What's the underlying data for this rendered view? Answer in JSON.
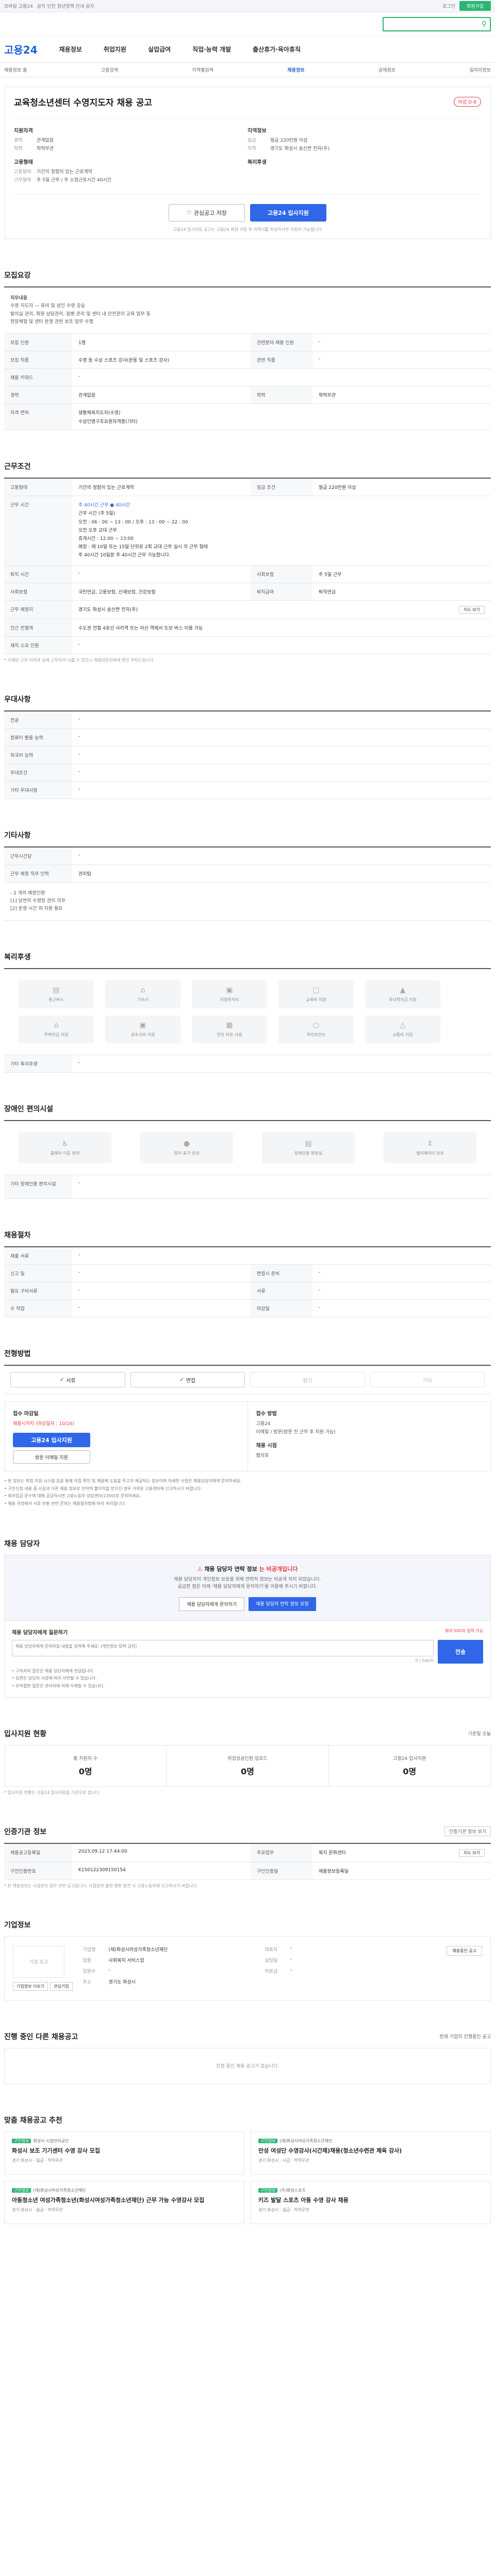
{
  "topbar": {
    "left": "모바일 고용24",
    "notice": "공지 인천 청년정책 안내 공지",
    "right": "로그인",
    "cta": "회원가입"
  },
  "search": {
    "icon": "search-icon"
  },
  "gnb": {
    "logo": "고용24",
    "menu": [
      "채용정보",
      "취업지원",
      "실업급여",
      "직업·능력 개발",
      "출산휴가·육아휴직"
    ]
  },
  "subnav": [
    "채용정보 홈",
    "고용검색",
    "지역별검색",
    "채용정보",
    "공채정보",
    "일자리정보"
  ],
  "job": {
    "title": "교육청소년센터 수영지도자 채용 공고",
    "dday": "마감 D-8",
    "left_head": "지원자격",
    "left_rows": [
      [
        "경력",
        "관계없음"
      ],
      [
        "학력",
        "학력무관"
      ]
    ],
    "left_head2": "고용형태",
    "left_rows2": [
      [
        "고용형태",
        "기간의 정함이 있는 근로계약"
      ],
      [
        "근무형태",
        "주 5일 근무 / 주 소정근로시간 40시간"
      ]
    ],
    "right_head": "지역정보",
    "right_rows": [
      [
        "임금",
        "월급 220만원 이상"
      ],
      [
        "지역",
        "경기도 화성시 송산면 전자(주)"
      ]
    ],
    "right_head2": "복리후생",
    "btn_scrap": "관심공고 저장",
    "btn_apply": "고용24 입사지원",
    "notice": "고용24 입사지원 공고는 고용24 회원 가입 후 이력서를 작성하시면 지원이 가능합니다"
  },
  "sec_recruit": {
    "title": "모집요강",
    "duty_label": "직무내용",
    "duty": "수영 지도자 — 유아 및 성인 수영 강습\n탈의실 관리, 회원 상담관리, 질병 관리 및 센터 내 안전관리 교육 업무 등\n현장체험 및 센터 운영 관련 보조 업무 수행",
    "rows": [
      [
        "모집 인원",
        "1명",
        "관련분야 채용 인원",
        "-"
      ],
      [
        "모집 직종",
        "수영 등 수상 스포츠 강사(운동 및 스포츠 강사)",
        "관련 직종",
        "-"
      ],
      [
        "채용 키워드",
        "-",
        "",
        ""
      ],
      [
        "경력",
        "관계없음",
        "학력",
        "학력무관"
      ]
    ],
    "license_label": "자격 면허",
    "licenses": [
      "생활체육지도자(수영)",
      "수상인명구조요원자격증(기타)"
    ]
  },
  "sec_work": {
    "title": "근무조건",
    "rows_top": [
      [
        "고용형태",
        "기간의 정함이 있는 근로계약",
        "임금 조건",
        "월급 220만원 이상"
      ]
    ],
    "bonus": "주 40시간 근무 ● 40시간",
    "time_label": "근무 시간",
    "time_lines": [
      "근무 시간 (주 5일)",
      "오전 : 06 : 00 ~ 13 : 00 / 오후 : 13 : 00 ~ 22 : 00",
      "오전 오후 교대 근무",
      "",
      "휴게시간 : 12:00 ~ 13:00",
      "",
      "예정 : 매 10일 또는 15일 단위로 2회 교대 근무 실시 의 근무 형태",
      "주 40시간 10일분 주 40시간 근무 가능합니다."
    ],
    "rows": [
      [
        "퇴직 시간",
        "-",
        "사회보험",
        "주 5일 근무"
      ],
      [
        "사회보험",
        "국민연금, 고용보험, 산재보험, 건강보험",
        "퇴직급여",
        "퇴직연금"
      ],
      [
        "근무 예정지",
        "경기도 화성시 송산면 전자(주)",
        "",
        ""
      ],
      [
        "인근 전철역",
        "수도권 전철 4호선 사리역 또는 아산 역에서 도보 버스 이용 가능",
        "",
        ""
      ],
      [
        "재직 소요 인원",
        "-",
        "",
        ""
      ]
    ],
    "map_btn": "지도 보기",
    "footnote": "* 기재된 근무 지역과 실제 근무지가 다를 수 있으니 채용담당자에게 확인 부탁드립니다."
  },
  "sec_prefer": {
    "title": "우대사항",
    "rows": [
      [
        "전공",
        "-"
      ],
      [
        "컴퓨터 활용 능력",
        "-"
      ],
      [
        "외국어 능력",
        "-"
      ],
      [
        "우대조건",
        "-"
      ],
      [
        "기타 우대사항",
        "-"
      ]
    ]
  },
  "sec_etc": {
    "title": "기타사항",
    "rows": [
      [
        "근무시간당",
        "-"
      ],
      [
        "근무 예정 직무 인력",
        "관리팀"
      ]
    ],
    "desc": "-  2 개의 예정인원\n[1] 당연히 수영장 관리 의무\n[2] 운영 시간 외 지원 필요"
  },
  "sec_welfare": {
    "title": "복리후생",
    "items": [
      "통근버스",
      "기숙사",
      "차량유지비",
      "교육비 지원",
      "자녀학자금 지원",
      "주택자금 지원",
      "경조사비 지원",
      "연차 자유 사용",
      "복지포인트",
      "교통비 지원"
    ],
    "etc_label": "기타 복리후생",
    "etc_value": "-"
  },
  "sec_disabled": {
    "title": "장애인 편의시설",
    "items": [
      "휠체어 이동 편의",
      "점자 표기 안내",
      "장애인용 화장실",
      "엘리베이터 보유"
    ],
    "etc_label": "기타 장애인용 편의시설",
    "etc_value": "-"
  },
  "sec_process": {
    "title": "채용절차",
    "rows": [
      [
        "제출 서류",
        "-",
        "",
        ""
      ],
      [
        "신고 일",
        "-",
        "면접시 준비",
        "-"
      ],
      [
        "필요 구비서류",
        "-",
        "서류",
        "-"
      ],
      [
        "수 작업",
        "-",
        "마감일",
        "-"
      ]
    ]
  },
  "sec_apply": {
    "title": "전형방법",
    "chips": [
      {
        "label": "서류",
        "on": true
      },
      {
        "label": "면접",
        "on": true
      },
      {
        "label": "필기",
        "on": false
      },
      {
        "label": "기타",
        "on": false
      }
    ],
    "left_head": "접수 마감일",
    "left_date": "채용시까지 (마감일자 : 10/16)",
    "left_btn": "고용24 입사지원",
    "left_btn2": "방문 이메일 지원",
    "right_head": "접수 방법",
    "right_lines": [
      "고용24",
      "이메일 / 방문(방문 전 근무 후 지원 가능)"
    ],
    "right_head2": "채용 시점",
    "right_val": "협의후",
    "bullets": [
      "• 본 정보는 취업 지원 시스템 등을 통해 직접 확인 및 채용에 도움을 주고자 제공되는 정보이며 자세한 사항은 채용담당자에게 문의하세요.",
      "• 구인신청 내용 중 사실과 다른 채용 정보로 인하여 불이익을 받으신 경우 가까운 고용센터에 신고하시기 바랍니다.",
      "• 최저임금 준수에 대해 궁금하시면 고용노동부 상담센터(1350)로 문의하세요.",
      "• 채용 과정에서 서류 반환 관련 문의는 채용절차법에 따라 처리됩니다."
    ]
  },
  "sec_contact": {
    "title": "채용 담당자",
    "banner_h1": "채용 담당자 연락 정보",
    "banner_h2": " 는 비공개입니다",
    "banner_p": "채용 담당자의 개인정보 보호를 위해 연락처 정보는 비공개 처리 되었습니다.\n궁금한 점은 아래 '채용 담당자에게 문의하기'를 이용해 주시기 바랍니다.",
    "b1": "채용 담당자에게 문의하기",
    "b2": "채용 담당자 연락 정보 요청",
    "inq_label": "채용 담당자에게 질문하기",
    "inq_right": "최대 500자 입력 가능",
    "inq_placeholder": "채용 담당자에게 문의하실 내용을 입력해 주세요. (개인정보 입력 금지)",
    "inq_count": "0 / 500자",
    "send": "전송",
    "notes": [
      "• 구직자의 질문은 채용 담당자에게 전달됩니다.",
      "• 답변은 담당자 사정에 따라 지연될 수 있습니다.",
      "• 부적절한 질문은 관리자에 의해 삭제될 수 있습니다."
    ]
  },
  "sec_stats": {
    "title": "입사지원 현황",
    "right": "기준일 오늘",
    "items": [
      [
        "총 지원자 수",
        "0명"
      ],
      [
        "취업성공인원 업로드",
        "0명"
      ],
      [
        "고용24 입사지원",
        "0명"
      ]
    ],
    "note": "* 입사지원 현황은 고용24 입사지원을 기준으로 합니다."
  },
  "sec_info": {
    "title": "인증기관 정보",
    "right": "인증기관 정보 보기",
    "rows": [
      [
        "채용공고등록일",
        "2023.09.12 17:44:00",
        "주요업무",
        "복지 문화센터"
      ],
      [
        "구인인증번호",
        "K150122309150154",
        "구인인증일",
        "채용정보등록일"
      ]
    ],
    "map_btn": "지도 보기",
    "note": "* 본 채용정보는 시설관리 업무 관련 공고입니다. 사업장의 불법 행위 발견 시 고용노동부에 신고하시기 바랍니다."
  },
  "sec_company": {
    "title": "기업정보",
    "logo": "기업 로고",
    "rows": [
      [
        "기업명",
        "(재)화성시여성가족청소년재단"
      ],
      [
        "업종",
        "사회복지 서비스업"
      ],
      [
        "업원수",
        "-"
      ],
      [
        "주소",
        "경기도 화성시"
      ]
    ],
    "right_rows": [
      [
        "대표자",
        "-"
      ],
      [
        "설립일",
        "-"
      ],
      [
        "자본금",
        "-"
      ]
    ],
    "link1": "기업정보 더보기",
    "link2": "관심기업",
    "btn_right": "채용중인 공고"
  },
  "sec_others": {
    "title": "진행 중인 다른 채용공고",
    "right": "현재 기업의 진행중인 공고",
    "empty": "진행 중인 채용 공고가 없습니다."
  },
  "sec_cards": {
    "title": "맞춤 채용공고 추천",
    "cards": [
      {
        "badge": "구인정보",
        "co": "화성시 시설관리공단",
        "title": "화성시 보조 기기센터 수영 강사 모집",
        "meta": "경기 화성시 · 월급 · 학력무관"
      },
      {
        "badge": "구인정보",
        "co": "(재)화성시여성가족청소년재단",
        "title": "안성 여성단 수영강사(시간제)채용(청소년수련관 체육 강사)",
        "meta": "경기 화성시 · 시급 · 학력무관"
      },
      {
        "badge": "구인정보",
        "co": "(재)화성시여성가족청소년재단",
        "title": "아동청소년 여성가족청소년(화성시여성가족청소년재단) 근무 가능 수영강사 모집",
        "meta": "경기 화성시 · 월급 · 학력무관"
      },
      {
        "badge": "구인정보",
        "co": "(주)화성스포츠",
        "title": "키즈 발달 스포츠 아동 수영 강사 채용",
        "meta": "경기 화성시 · 월급 · 학력무관"
      }
    ]
  }
}
